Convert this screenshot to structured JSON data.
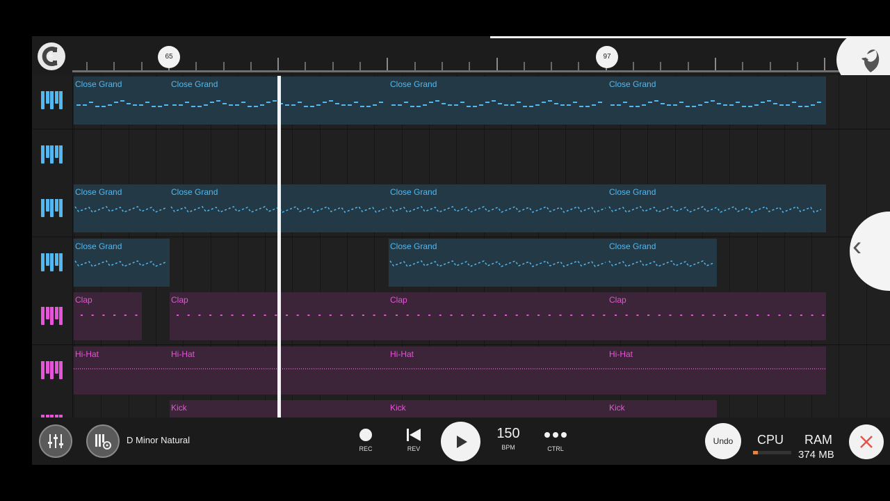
{
  "ruler": {
    "markers": [
      "65",
      "97"
    ]
  },
  "tracks": [
    {
      "name": "track-1",
      "color": "blue",
      "clips": [
        {
          "label": "Close Grand"
        },
        {
          "label": "Close Grand"
        },
        {
          "label": "Close Grand"
        },
        {
          "label": "Close Grand"
        }
      ]
    },
    {
      "name": "track-2",
      "color": "blue",
      "clips": []
    },
    {
      "name": "track-3",
      "color": "blue",
      "clips": [
        {
          "label": "Close Grand"
        },
        {
          "label": "Close Grand"
        },
        {
          "label": "Close Grand"
        },
        {
          "label": "Close Grand"
        }
      ]
    },
    {
      "name": "track-4",
      "color": "blue",
      "clips": [
        {
          "label": "Close Grand"
        },
        {
          "label": "Close Grand"
        },
        {
          "label": "Close Grand"
        }
      ]
    },
    {
      "name": "track-5",
      "color": "pink",
      "clips": [
        {
          "label": "Clap"
        },
        {
          "label": "Clap"
        },
        {
          "label": "Clap"
        },
        {
          "label": "Clap"
        }
      ]
    },
    {
      "name": "track-6",
      "color": "pink",
      "clips": [
        {
          "label": "Hi-Hat"
        },
        {
          "label": "Hi-Hat"
        },
        {
          "label": "Hi-Hat"
        },
        {
          "label": "Hi-Hat"
        }
      ]
    },
    {
      "name": "track-7",
      "color": "pink",
      "clips": [
        {
          "label": "Kick"
        },
        {
          "label": "Kick"
        },
        {
          "label": "Kick"
        }
      ]
    }
  ],
  "bottom": {
    "scale": "D Minor Natural",
    "rec_label": "REC",
    "rev_label": "REV",
    "bpm_value": "150",
    "bpm_label": "BPM",
    "ctrl_label": "CTRL",
    "undo_label": "Undo",
    "cpu_label": "CPU",
    "cpu_load": 0.12,
    "ram_label": "RAM",
    "ram_value": "374 MB"
  },
  "colors": {
    "blue_accent": "#53b8f0",
    "pink_accent": "#e455d8",
    "cpu_bar": "#e7843a"
  },
  "icons": [
    "snap-magnet-icon",
    "fl-studio-logo-icon",
    "piano-roll-icon",
    "mixer-icon",
    "instrument-settings-icon",
    "record-icon",
    "rewind-icon",
    "play-icon",
    "more-dots-icon",
    "close-icon",
    "chevron-left-icon"
  ]
}
